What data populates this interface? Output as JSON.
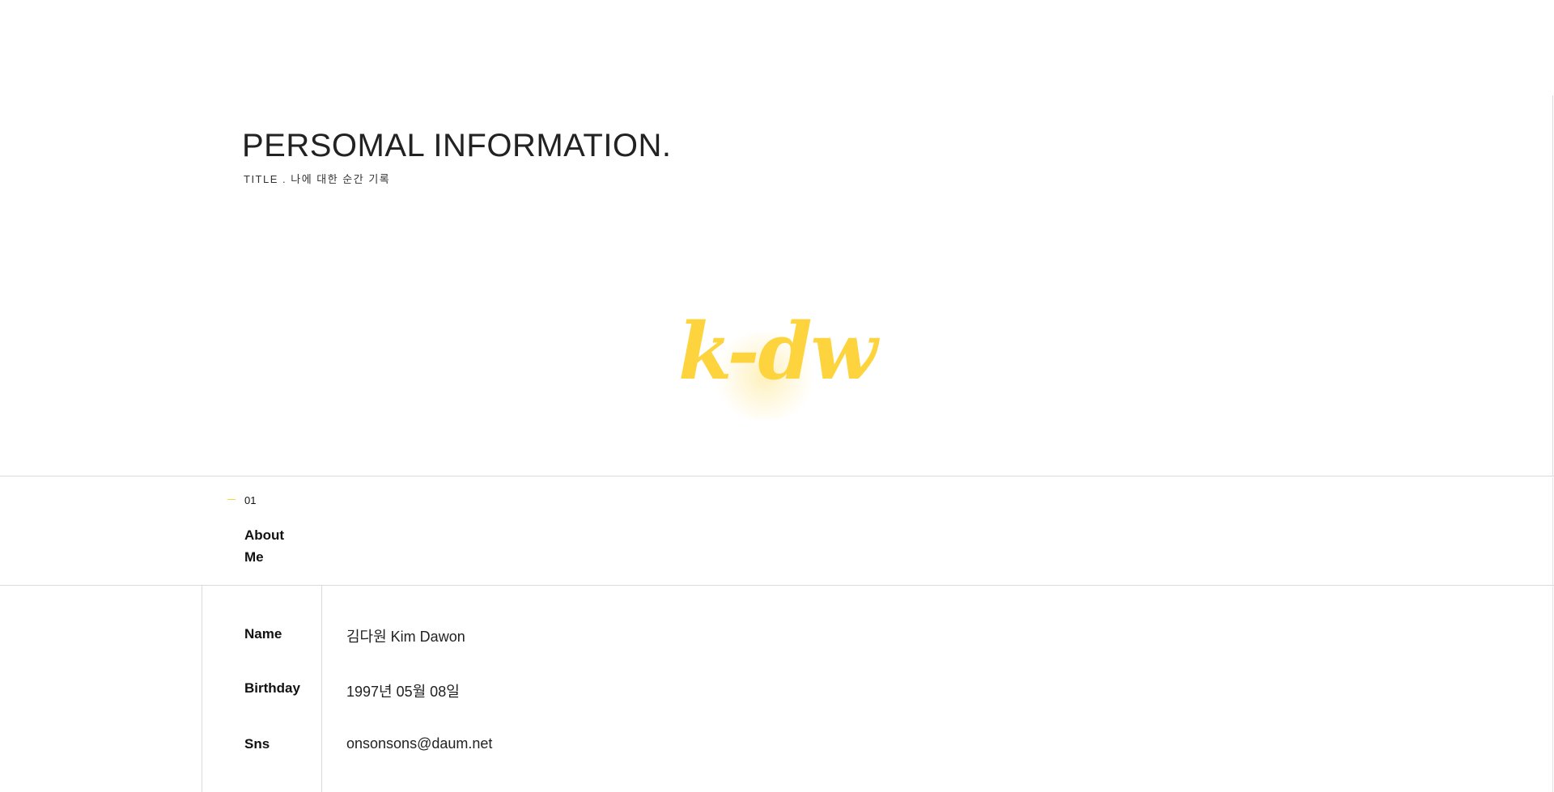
{
  "header": {
    "title": "PERSOMAL INFORMATION.",
    "subtitle": "TITLE . 나에 대한 순간 기록"
  },
  "logo": {
    "text": "k-dw",
    "color": "#fdd43e"
  },
  "section": {
    "number": "01",
    "title": "About Me",
    "accent_color": "#fdd43e"
  },
  "profile": {
    "rows": [
      {
        "label": "Name",
        "value": "김다원  Kim Dawon"
      },
      {
        "label": "Birthday",
        "value": "1997년 05월 08일"
      },
      {
        "label": "Sns",
        "value": "onsonsons@daum.net"
      }
    ]
  }
}
